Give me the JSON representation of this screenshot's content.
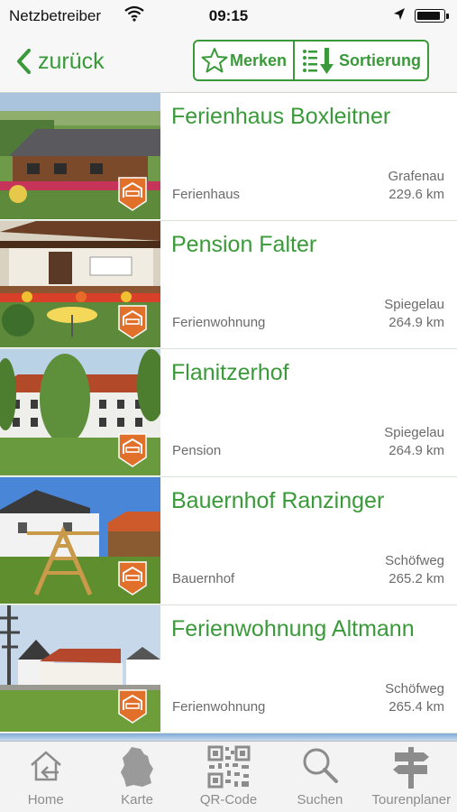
{
  "status_bar": {
    "carrier": "Netzbetreiber",
    "time": "09:15",
    "battery_level": 0.9
  },
  "nav": {
    "back_label": "zurück",
    "merken_label": "Merken",
    "sort_label": "Sortierung",
    "accent_color": "#3a9a3a"
  },
  "listings": [
    {
      "title": "Ferienhaus Boxleitner",
      "category": "Ferienhaus",
      "place": "Grafenau",
      "distance": "229.6 km",
      "image": "house-photo"
    },
    {
      "title": "Pension Falter",
      "category": "Ferienwohnung",
      "place": "Spiegelau",
      "distance": "264.9 km",
      "image": "pension-photo"
    },
    {
      "title": "Flanitzerhof",
      "category": "Pension",
      "place": "Spiegelau",
      "distance": "264.9 km",
      "image": "farmhouse-photo"
    },
    {
      "title": "Bauernhof Ranzinger",
      "category": "Bauernhof",
      "place": "Schöfweg",
      "distance": "265.2 km",
      "image": "farm-playground-photo"
    },
    {
      "title": "Ferienwohnung Altmann",
      "category": "Ferienwohnung",
      "place": "Schöfweg",
      "distance": "265.4 km",
      "image": "village-photo"
    }
  ],
  "tab_bar": {
    "tabs": [
      {
        "label": "Home",
        "icon": "home-icon"
      },
      {
        "label": "Karte",
        "icon": "map-germany-icon"
      },
      {
        "label": "QR-Code",
        "icon": "qr-code-icon"
      },
      {
        "label": "Suchen",
        "icon": "search-icon"
      },
      {
        "label": "Tourenplaner",
        "icon": "signpost-icon"
      }
    ]
  }
}
